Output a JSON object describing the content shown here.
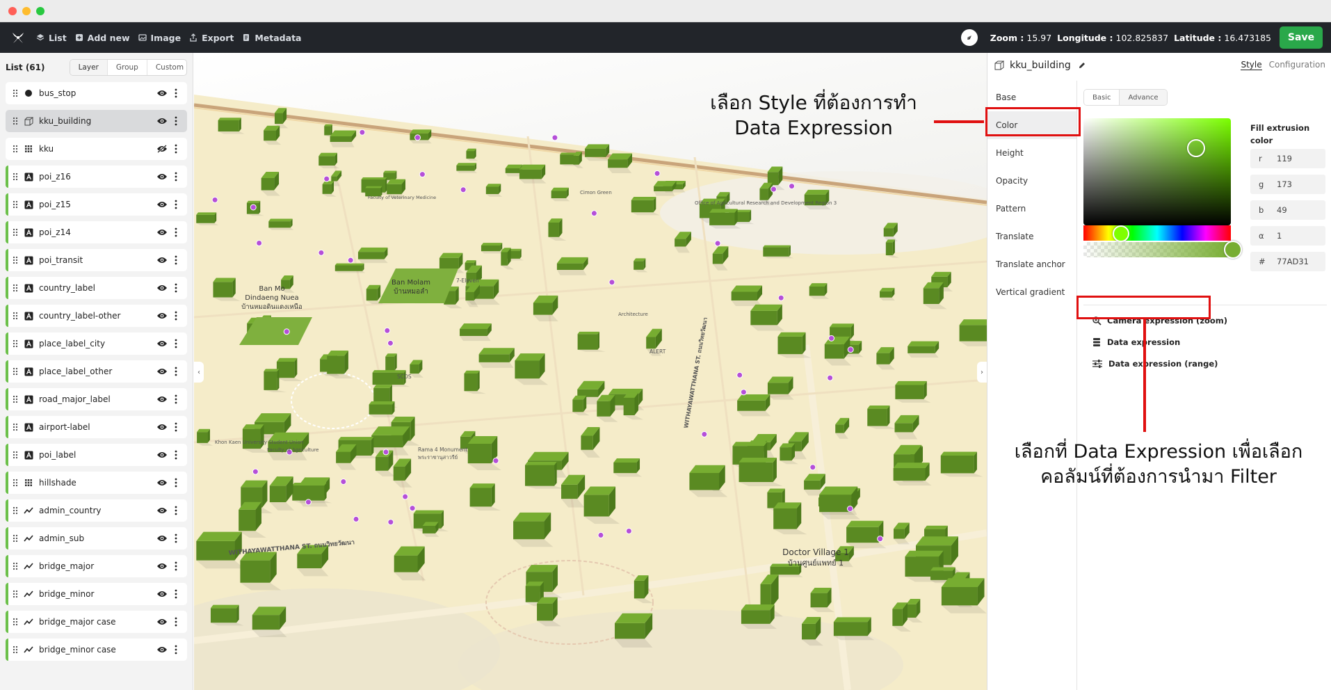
{
  "topbar": {
    "menu": [
      {
        "label": "List",
        "icon": "layers-icon"
      },
      {
        "label": "Add new",
        "icon": "add-icon"
      },
      {
        "label": "Image",
        "icon": "image-icon"
      },
      {
        "label": "Export",
        "icon": "export-icon"
      },
      {
        "label": "Metadata",
        "icon": "metadata-icon"
      }
    ],
    "zoom_label": "Zoom :",
    "zoom_value": "15.97",
    "lon_label": "Longitude :",
    "lon_value": "102.825837",
    "lat_label": "Latitude :",
    "lat_value": "16.473185",
    "save_label": "Save"
  },
  "left": {
    "title": "List (61)",
    "tabs": [
      "Layer",
      "Group",
      "Custom"
    ],
    "active_tab": "Layer",
    "layers": [
      {
        "name": "bus_stop",
        "type": "circle",
        "visible": true,
        "bar": false
      },
      {
        "name": "kku_building",
        "type": "fill-extrusion",
        "visible": true,
        "bar": false,
        "selected": true
      },
      {
        "name": "kku",
        "type": "raster",
        "visible": false,
        "bar": false
      },
      {
        "name": "poi_z16",
        "type": "symbol",
        "visible": true,
        "bar": true
      },
      {
        "name": "poi_z15",
        "type": "symbol",
        "visible": true,
        "bar": true
      },
      {
        "name": "poi_z14",
        "type": "symbol",
        "visible": true,
        "bar": true
      },
      {
        "name": "poi_transit",
        "type": "symbol",
        "visible": true,
        "bar": true
      },
      {
        "name": "country_label",
        "type": "symbol",
        "visible": true,
        "bar": true
      },
      {
        "name": "country_label-other",
        "type": "symbol",
        "visible": true,
        "bar": true
      },
      {
        "name": "place_label_city",
        "type": "symbol",
        "visible": true,
        "bar": true
      },
      {
        "name": "place_label_other",
        "type": "symbol",
        "visible": true,
        "bar": true
      },
      {
        "name": "road_major_label",
        "type": "symbol",
        "visible": true,
        "bar": true
      },
      {
        "name": "airport-label",
        "type": "symbol",
        "visible": true,
        "bar": true
      },
      {
        "name": "poi_label",
        "type": "symbol",
        "visible": true,
        "bar": true
      },
      {
        "name": "hillshade",
        "type": "raster",
        "visible": true,
        "bar": true
      },
      {
        "name": "admin_country",
        "type": "line",
        "visible": true,
        "bar": true
      },
      {
        "name": "admin_sub",
        "type": "line",
        "visible": true,
        "bar": true
      },
      {
        "name": "bridge_major",
        "type": "line",
        "visible": true,
        "bar": true
      },
      {
        "name": "bridge_minor",
        "type": "line",
        "visible": true,
        "bar": true
      },
      {
        "name": "bridge_major case",
        "type": "line",
        "visible": true,
        "bar": true
      },
      {
        "name": "bridge_minor case",
        "type": "line",
        "visible": true,
        "bar": true
      }
    ]
  },
  "map": {
    "labels": [
      {
        "text": "Ban Mo",
        "cls": "place"
      },
      {
        "text": "Dindaeng Nuea",
        "cls": "place"
      },
      {
        "text": "บ้านหมอดินแดงเหนือ",
        "cls": "place"
      },
      {
        "text": "Ban Molam",
        "cls": "place"
      },
      {
        "text": "บ้านหมอลำ",
        "cls": "place"
      },
      {
        "text": "Doctor Village 1",
        "cls": "place"
      },
      {
        "text": "บ้านศูนย์แพทย์ 1",
        "cls": "place"
      },
      {
        "text": "WITHAYAWATTHANA ST. ถนนวิทยวัฒนา",
        "cls": "road"
      },
      {
        "text": "WITHAYAWATTHANA ST. ถนนวิทยวัฒนา",
        "cls": "road"
      },
      {
        "text": "Office of Agricultural Research and Development Region 3",
        "cls": "poi"
      },
      {
        "text": "Cimon Green",
        "cls": "poi"
      },
      {
        "text": "7-Eleven",
        "cls": "poi"
      },
      {
        "text": "ALERT",
        "cls": "poi"
      },
      {
        "text": "SCOS",
        "cls": "poi"
      },
      {
        "text": "Rama 4 Monument",
        "cls": "poi"
      },
      {
        "text": "พระราชานุสาวรีย์",
        "cls": "poi"
      },
      {
        "text": "Khon Kaen University Student Union",
        "cls": "poi"
      },
      {
        "text": "Faculty of Agriculture",
        "cls": "poi"
      },
      {
        "text": "Architecture",
        "cls": "poi"
      },
      {
        "text": "Faculty of Veterinary Medicine",
        "cls": "poi"
      }
    ]
  },
  "right": {
    "layer_name": "kku_building",
    "tabs": [
      "Style",
      "Configuration"
    ],
    "nav": [
      "Base",
      "Color",
      "Height",
      "Opacity",
      "Pattern",
      "Translate",
      "Translate anchor",
      "Vertical gradient"
    ],
    "active_nav": "Color",
    "mode_tabs": [
      "Basic",
      "Advance"
    ],
    "fill_label": "Fill extrusion color",
    "color": {
      "r": "119",
      "g": "173",
      "b": "49",
      "a": "1",
      "hex": "77AD31"
    },
    "expressions": [
      {
        "label": "Camera expression (zoom)",
        "icon": "camera-zoom-icon"
      },
      {
        "label": "Data expression",
        "icon": "data-expression-icon"
      },
      {
        "label": "Data expression (range)",
        "icon": "range-sliders-icon"
      }
    ]
  },
  "annotations": {
    "top_line1": "เลือก Style ที่ต้องการทำ",
    "top_line2": "Data Expression",
    "bottom_line1": "เลือกที่ Data Expression เพื่อเลือก",
    "bottom_line2": "คอลัมน์ที่ต้องการนำมา Filter"
  },
  "colors": {
    "accent_green": "#2aa84a",
    "building": "#77AD31",
    "annotation_red": "#e01010",
    "topbar": "#22252a"
  }
}
